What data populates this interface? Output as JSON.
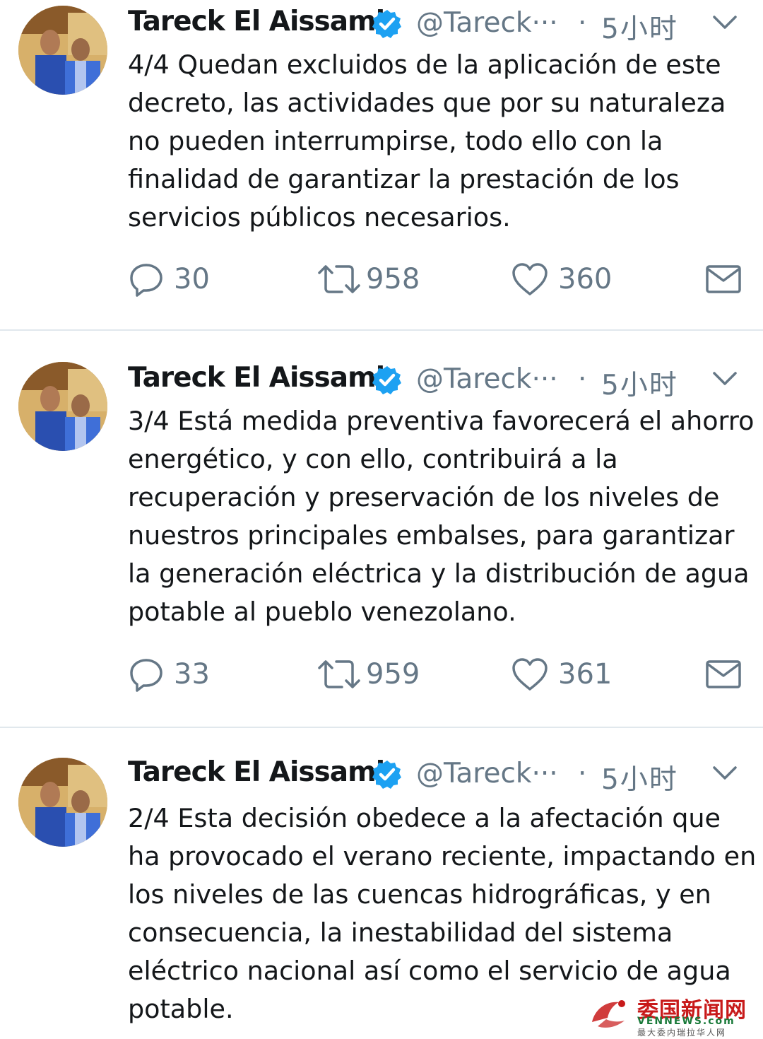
{
  "tweets": [
    {
      "author": {
        "name": "Tareck El Aissami",
        "handle": "@Tareck···",
        "verified": true
      },
      "separator": "·",
      "time": "5小时",
      "text": "4/4 Quedan excluidos de la aplicación de este decreto, las actividades que por su naturaleza no pueden interrumpirse, todo ello con la finalidad de garantizar la prestación de los servicios públicos necesarios.",
      "stats": {
        "replies": "30",
        "retweets": "958",
        "likes": "360"
      }
    },
    {
      "author": {
        "name": "Tareck El Aissami",
        "handle": "@Tareck···",
        "verified": true
      },
      "separator": "·",
      "time": "5小时",
      "text": "3/4 Está medida preventiva favorecerá el ahorro energético, y con ello, contribuirá a la recuperación y preservación de los niveles de nuestros principales embalses, para garantizar la generación eléctrica y la distribución de agua potable al pueblo venezolano.",
      "stats": {
        "replies": "33",
        "retweets": "959",
        "likes": "361"
      }
    },
    {
      "author": {
        "name": "Tareck El Aissami",
        "handle": "@Tareck···",
        "verified": true
      },
      "separator": "·",
      "time": "5小时",
      "text": "2/4 Esta decisión obedece a la afectación que ha provocado el verano reciente, impactando en los niveles de las cuencas hidrográficas, y en consecuencia, la inestabilidad del sistema eléctrico nacional así como el servicio de agua potable.",
      "stats": null
    }
  ],
  "icons": {
    "verified": "verified-badge-icon",
    "more": "chevron-down-icon",
    "reply": "reply-icon",
    "retweet": "retweet-icon",
    "like": "heart-icon",
    "dm": "envelope-icon"
  },
  "watermark": {
    "title": "委国新闻网",
    "site": "VENNEWS.com",
    "subtitle": "最大委内瑞拉华人网"
  },
  "colors": {
    "text": "#14171a",
    "secondary": "#657786",
    "verified": "#1da1f2",
    "divider": "#e1e8ed",
    "watermark_red": "#c81a1a",
    "watermark_green": "#1a7a3a"
  }
}
